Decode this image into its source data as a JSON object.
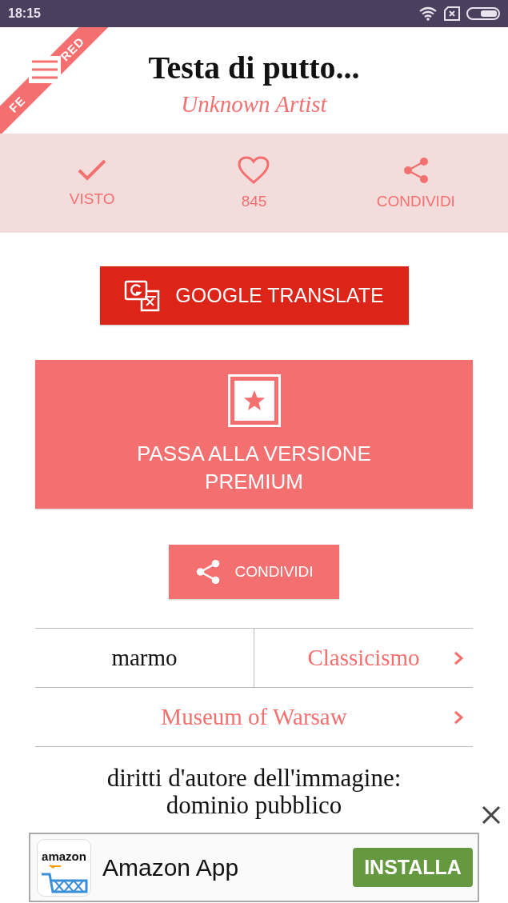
{
  "status_bar": {
    "time": "18:15"
  },
  "ribbon": {
    "visible_parts": [
      "FE",
      "RED"
    ]
  },
  "header": {
    "title": "Testa di putto...",
    "subtitle": "Unknown Artist"
  },
  "actions": [
    {
      "kind": "check",
      "label": "VISTO"
    },
    {
      "kind": "heart",
      "label": "845"
    },
    {
      "kind": "share",
      "label": "CONDIVIDI"
    }
  ],
  "translate_button": {
    "label": "GOOGLE TRANSLATE"
  },
  "premium_button": {
    "label": "PASSA ALLA VERSIONE PREMIUM"
  },
  "share_button": {
    "label": "CONDIVIDI"
  },
  "details": [
    [
      {
        "text": "marmo",
        "link": false
      },
      {
        "text": "Classicismo",
        "link": true
      }
    ],
    [
      {
        "text": "Museum of Warsaw",
        "link": true
      }
    ]
  ],
  "copyright": "diritti d'autore dell'immagine: dominio pubblico",
  "ad": {
    "app_name": "Amazon App",
    "logo_text": "amazon",
    "button": "INSTALLA"
  }
}
